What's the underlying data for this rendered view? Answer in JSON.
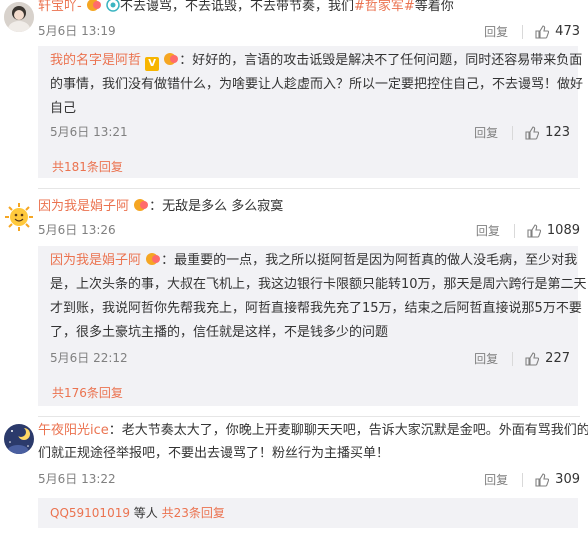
{
  "comments": [
    {
      "user": "轩宝吖-",
      "text_prefix": "不去谩骂，不去诋毁，不去带节奏，我们",
      "topic": "#哲家军#",
      "text_suffix": "等着你",
      "time": "5月6日 13:19",
      "reply_label": "回复",
      "likes": "473",
      "reply": {
        "user": "我的名字是阿哲",
        "line1": "：好好的，言语的攻击诋毁是解决不了任何问题，同时还容易带来负面",
        "line2": "的事情，我们没有做错什么，为啥要让人趁虚而入？所以一定要把控住自己，不去谩骂！做好",
        "line3": "自己",
        "time": "5月6日 13:21",
        "reply_label": "回复",
        "likes": "123"
      },
      "more": "共181条回复"
    },
    {
      "user": "因为我是娟子阿",
      "text": "：无敌是多么 多么寂寞",
      "time": "5月6日 13:26",
      "reply_label": "回复",
      "likes": "1089",
      "reply": {
        "user": "因为我是娟子阿",
        "line1": "：最重要的一点，我之所以挺阿哲是因为阿哲真的做人没毛病，至少对我",
        "line2": "是，上次头条的事，大叔在飞机上，我这边银行卡限额只能转10万，那天是周六跨行是第二天",
        "line3": "才到账，我说阿哲你先帮我充上，阿哲直接帮我先充了15万，结束之后阿哲直接说那5万不要",
        "line4": "了，很多土豪坑主播的，信任就是这样，不是钱多少的问题",
        "time": "5月6日 22:12",
        "reply_label": "回复",
        "likes": "227"
      },
      "more": "共176条回复"
    },
    {
      "user": "午夜阳光ice",
      "line1": "：老大节奏太大了，你晚上开麦聊聊天天吧，告诉大家沉默是金吧。外面有骂我们的我",
      "line2": "们就正规途径举报吧，不要出去谩骂了！粉丝行为主播买单！",
      "time": "5月6日 13:22",
      "reply_label": "回复",
      "likes": "309",
      "sub_user": "QQ59101019",
      "sub_mid": "等人",
      "more": "共23条回复"
    }
  ],
  "colors": {
    "accent": "#eb7350",
    "meta": "#808080",
    "reply_bg": "#f2f2f5"
  }
}
